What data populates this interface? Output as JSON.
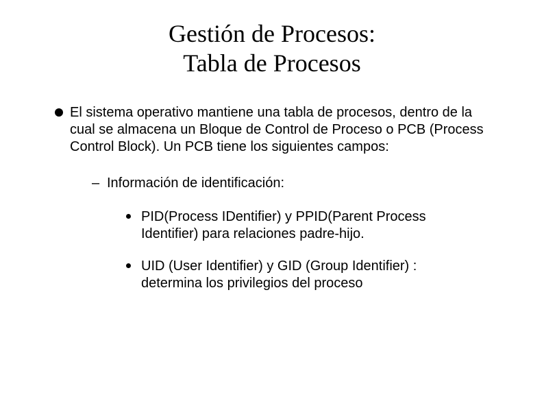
{
  "title": {
    "line1": "Gestión de Procesos:",
    "line2": "Tabla de Procesos"
  },
  "body": {
    "main_point": "El sistema operativo mantiene una tabla de procesos, dentro de la cual se almacena un Bloque de Control de Proceso o PCB (Process Control Block). Un PCB tiene los siguientes campos:",
    "sub1_label": "Información de identificación:",
    "sub2_items": [
      "PID(Process IDentifier) y PPID(Parent Process Identifier) para relaciones padre-hijo.",
      "UID (User Identifier) y GID (Group Identifier) : determina los privilegios del proceso"
    ]
  }
}
